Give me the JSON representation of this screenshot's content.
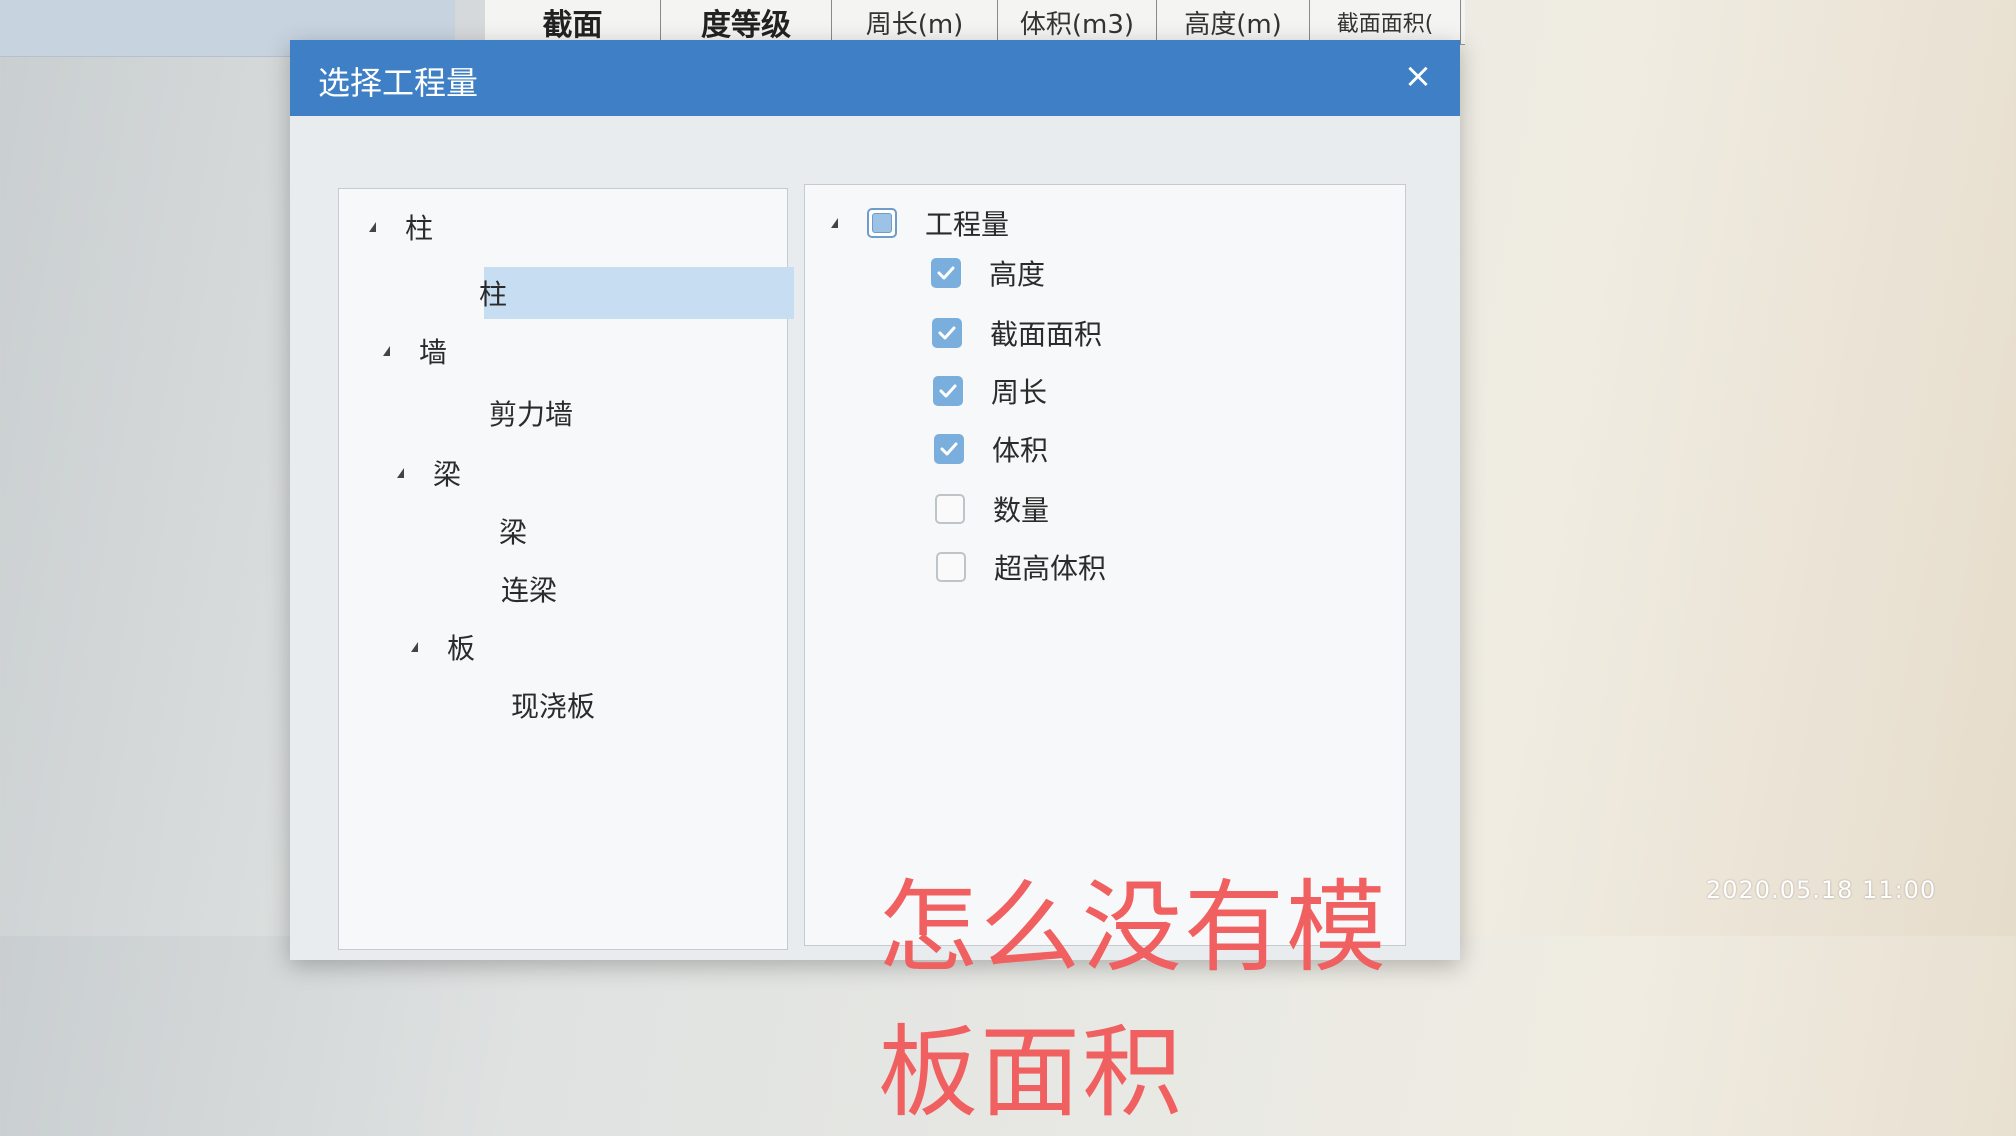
{
  "background_table": {
    "headers": [
      "截面",
      "度等级",
      "周长(m)",
      "体积(m3)",
      "高度(m)",
      "截面面积("
    ]
  },
  "dialog": {
    "title": "选择工程量",
    "close_label": "×"
  },
  "left_tree": {
    "groups": [
      {
        "label": "柱",
        "children": [
          "柱"
        ]
      },
      {
        "label": "墙",
        "children": [
          "剪力墙"
        ]
      },
      {
        "label": "梁",
        "children": [
          "梁",
          "连梁"
        ]
      },
      {
        "label": "板",
        "children": [
          "现浇板"
        ]
      }
    ],
    "selected": "柱"
  },
  "right_tree": {
    "root_label": "工程量",
    "root_state": "partial",
    "items": [
      {
        "label": "高度",
        "checked": true
      },
      {
        "label": "截面面积",
        "checked": true
      },
      {
        "label": "周长",
        "checked": true
      },
      {
        "label": "体积",
        "checked": true
      },
      {
        "label": "数量",
        "checked": false
      },
      {
        "label": "超高体积",
        "checked": false
      }
    ]
  },
  "annotation_text": "怎么没有模板面积",
  "timestamp": "2020.05.18 11:00",
  "colors": {
    "titlebar": "#3f7fc6",
    "checkbox_on": "#7aaedc",
    "selection": "#c7ddf2",
    "annotation": "#f06060"
  }
}
